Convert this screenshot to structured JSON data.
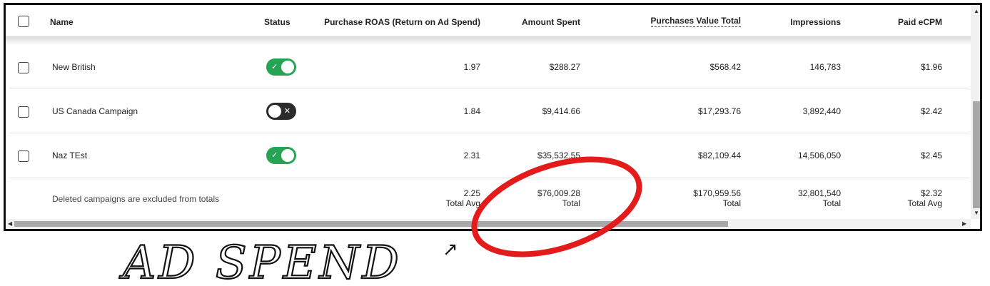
{
  "columns": {
    "name": "Name",
    "status": "Status",
    "roas": "Purchase ROAS (Return on Ad Spend)",
    "spent": "Amount Spent",
    "pvt": "Purchases Value Total",
    "impressions": "Impressions",
    "ecpm": "Paid eCPM"
  },
  "rows": [
    {
      "name": "New British",
      "status": "on",
      "status_glyph": "✓",
      "roas": "1.97",
      "spent": "$288.27",
      "pvt": "$568.42",
      "impressions": "146,783",
      "ecpm": "$1.96"
    },
    {
      "name": "US Canada Campaign",
      "status": "off",
      "status_glyph": "✕",
      "roas": "1.84",
      "spent": "$9,414.66",
      "pvt": "$17,293.76",
      "impressions": "3,892,440",
      "ecpm": "$2.42"
    },
    {
      "name": "Naz TEst",
      "status": "on",
      "status_glyph": "✓",
      "roas": "2.31",
      "spent": "$35,532.55",
      "pvt": "$82,109.44",
      "impressions": "14,506,050",
      "ecpm": "$2.45"
    }
  ],
  "totals": {
    "note": "Deleted campaigns are excluded from totals",
    "roas": "2.25",
    "roas_label": "Total Avg",
    "spent": "$76,009.28",
    "spent_label": "Total",
    "pvt": "$170,959.56",
    "pvt_label": "Total",
    "impressions": "32,801,540",
    "impressions_label": "Total",
    "ecpm": "$2.32",
    "ecpm_label": "Total Avg"
  },
  "annotation": {
    "text": "AD SPEND",
    "arrow": "↗",
    "circle_color": "#e31b1b"
  },
  "icons": {
    "checkbox": "checkbox-icon",
    "check": "check-icon",
    "cross": "x-icon",
    "scroll_up": "▲",
    "scroll_down": "▼",
    "scroll_left": "◀",
    "scroll_right": "▶"
  }
}
